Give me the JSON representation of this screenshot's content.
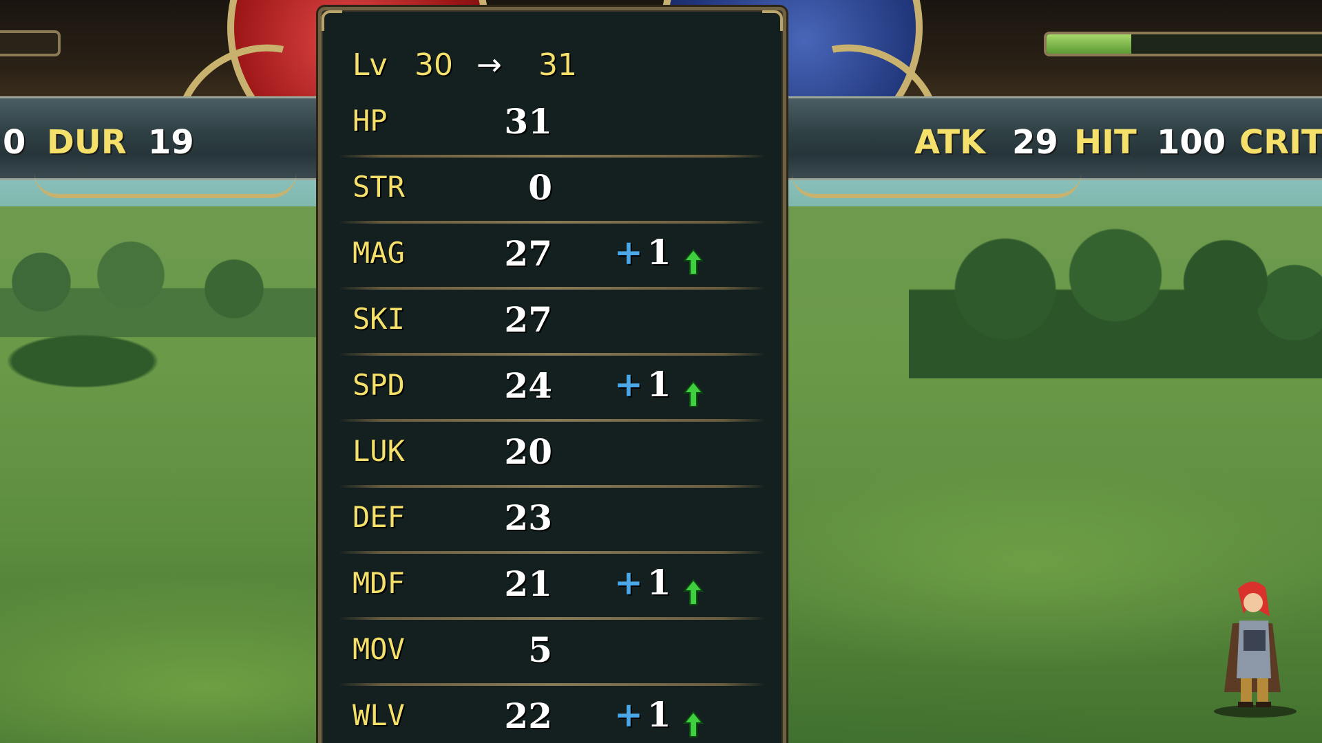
{
  "hud": {
    "left_prefix_value": "0",
    "left_label": "DUR",
    "left_value": "19",
    "right_stats": [
      {
        "label": "ATK",
        "value": "29"
      },
      {
        "label": "HIT",
        "value": "100"
      },
      {
        "label": "CRIT",
        "value": ""
      }
    ],
    "right_gauge_fill": 0.28
  },
  "level": {
    "label": "Lv",
    "from": "30",
    "arrow": "→",
    "to": "31"
  },
  "stats": [
    {
      "name": "HP",
      "value": "31",
      "gain": "",
      "gain_value": ""
    },
    {
      "name": "STR",
      "value": "0",
      "gain": "",
      "gain_value": ""
    },
    {
      "name": "MAG",
      "value": "27",
      "gain": "+",
      "gain_value": "1"
    },
    {
      "name": "SKI",
      "value": "27",
      "gain": "",
      "gain_value": ""
    },
    {
      "name": "SPD",
      "value": "24",
      "gain": "+",
      "gain_value": "1"
    },
    {
      "name": "LUK",
      "value": "20",
      "gain": "",
      "gain_value": ""
    },
    {
      "name": "DEF",
      "value": "23",
      "gain": "",
      "gain_value": ""
    },
    {
      "name": "MDF",
      "value": "21",
      "gain": "+",
      "gain_value": "1"
    },
    {
      "name": "MOV",
      "value": "5",
      "gain": "",
      "gain_value": ""
    },
    {
      "name": "WLV",
      "value": "22",
      "gain": "+",
      "gain_value": "1"
    }
  ],
  "colors": {
    "stat_label": "#f4e06a",
    "plus_sign": "#4aa8e8",
    "up_arrow": "#3fcf3f"
  }
}
